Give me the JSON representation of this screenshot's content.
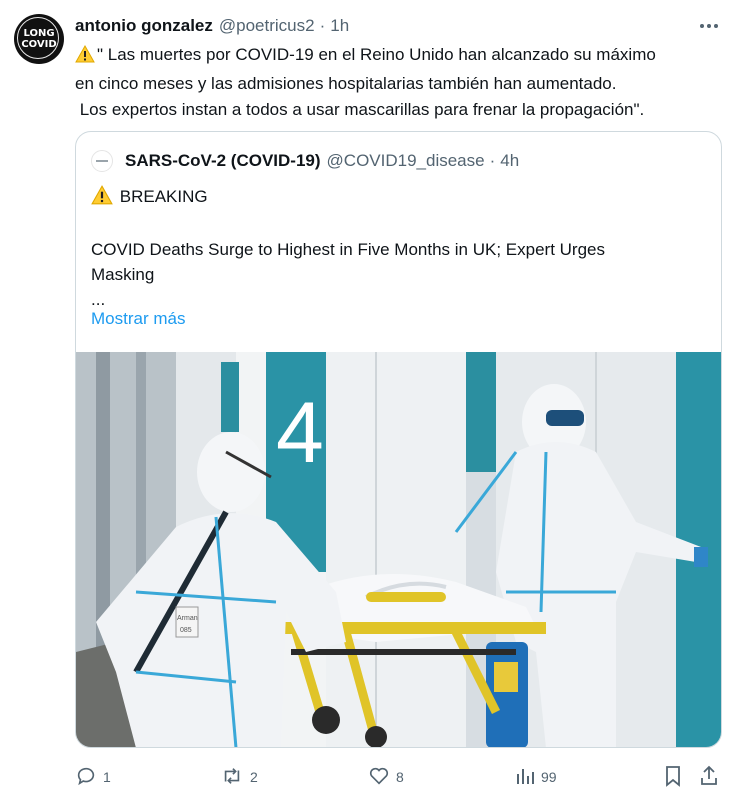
{
  "author": {
    "name": "antonio gonzalez",
    "handle": "@poetricus2",
    "separator": "·",
    "time": "1h",
    "avatar_text_line1": "LONG",
    "avatar_text_line2": "COVID"
  },
  "tweet": {
    "lines": [
      "\" Las muertes por COVID-19 en el Reino Unido han alcanzado su máximo",
      "en cinco meses y las admisiones hospitalarias también han aumentado.",
      " Los expertos instan a todos a usar mascarillas para frenar la propagación\"."
    ]
  },
  "quoted": {
    "name": "SARS-CoV-2 (COVID-19)",
    "handle": "@COVID19_disease",
    "separator": "·",
    "time": "4h",
    "breaking": "BREAKING",
    "headline_line1": "COVID Deaths Surge to Highest in Five Months in UK; Expert Urges",
    "headline_line2": "Masking",
    "ellipsis": "...",
    "show_more": "Mostrar más"
  },
  "media": {
    "sign_number": "4",
    "tag_label": "Arman",
    "tag_number": "085"
  },
  "actions": {
    "replies": "1",
    "retweets": "2",
    "likes": "8",
    "views": "99"
  },
  "colors": {
    "link": "#1d9bf0",
    "muted": "#536471",
    "text": "#0f1419"
  }
}
